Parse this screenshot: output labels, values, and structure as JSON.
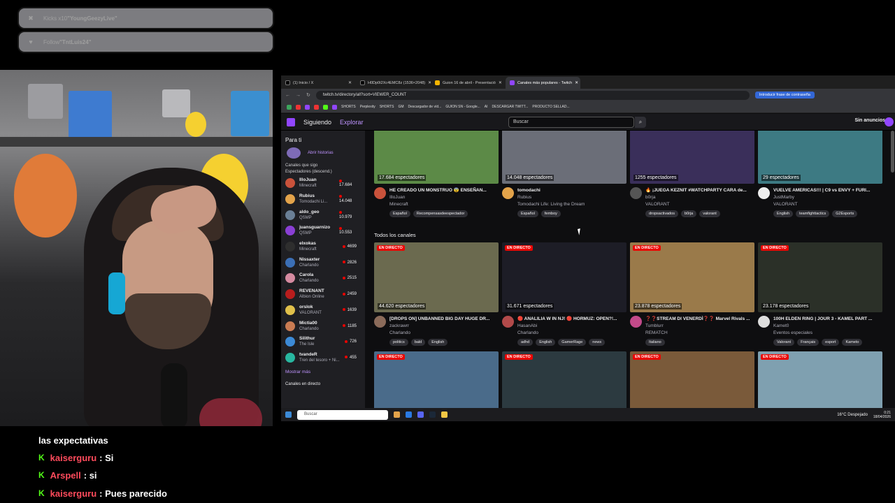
{
  "overlay": {
    "alerts": [
      {
        "icon": "kick-icon",
        "prefix": "Kicks x10 ",
        "name": "\"YoungGeezyLive\""
      },
      {
        "icon": "heart-icon",
        "prefix": "Follow ",
        "name": "\"TntLuis24\""
      }
    ],
    "chat": [
      {
        "user": "",
        "text": "las expectativas"
      },
      {
        "user": "kaiserguru",
        "text": ": Si"
      },
      {
        "user": "Arspell",
        "text": ": si"
      },
      {
        "user": "kaiserguru",
        "text": ": Pues parecido"
      }
    ],
    "chat_icon": "K",
    "colors": {
      "kick": "#53fc18",
      "chat_user": "#ff4b5c",
      "twitch": "#9146ff"
    }
  },
  "browser": {
    "tabs": [
      {
        "label": "(1) Inicio / X",
        "active": false
      },
      {
        "label": "H0Dp0t2Xc4EMC8z (1536×2048)",
        "active": false
      },
      {
        "label": "Guion 16 de abril - Presentació",
        "active": false
      },
      {
        "label": "Canales más populares - Twitch",
        "active": true
      }
    ],
    "url": "twitch.tv/directory/all?sort=VIEWER_COUNT",
    "password_btn": "Introducir frase de contraseña",
    "bookmarks": [
      "SHORTS",
      "Perplexity",
      "SHORTS",
      "GM",
      "Descargador de víd...",
      "GUION SN - Google...",
      "AI",
      "DESCARGAR TWITT...",
      "PRODUCTO SELLAD..."
    ]
  },
  "twitch": {
    "nav": {
      "following": "Siguiendo",
      "browse": "Explorar"
    },
    "search_placeholder": "Buscar",
    "no_ads": "Sin anuncios",
    "sidebar": {
      "for_you": "Para ti",
      "history": "Abrir historias",
      "followed": "Canales que sigo",
      "sort": "Espectadores (descend.)",
      "channels": [
        {
          "name": "IlloJuan",
          "game": "Minecraft",
          "viewers": "17.684",
          "color": "#c9523b"
        },
        {
          "name": "Rubius",
          "game": "Tomodachi Li...",
          "viewers": "14.048",
          "color": "#e3a34a"
        },
        {
          "name": "aldo_geo",
          "game": "QSMP",
          "viewers": "10.979",
          "color": "#6a7f96"
        },
        {
          "name": "juansguarnizo",
          "game": "QSMP",
          "viewers": "10.553",
          "color": "#8a3fd4"
        },
        {
          "name": "elxokas",
          "game": "Minecraft",
          "viewers": "4699",
          "color": "#2e2e2e"
        },
        {
          "name": "Nissaxter",
          "game": "Charlando",
          "viewers": "2826",
          "color": "#3b6fb6"
        },
        {
          "name": "Carola",
          "game": "Charlando",
          "viewers": "2515",
          "color": "#d58aa0"
        },
        {
          "name": "REVENANT",
          "game": "Albion Online",
          "viewers": "2459",
          "color": "#b81d1d"
        },
        {
          "name": "orslok",
          "game": "VALORANT",
          "viewers": "1639",
          "color": "#e0c04a"
        },
        {
          "name": "Mictia00",
          "game": "Charlando",
          "viewers": "1185",
          "color": "#c97b52"
        },
        {
          "name": "Silithur",
          "game": "The Isle",
          "viewers": "726",
          "color": "#3c8ad6"
        },
        {
          "name": "tvandeR",
          "game": "Tren del tesoro + Ni...",
          "viewers": "455",
          "color": "#28b7a0"
        }
      ],
      "show_more": "Mostrar más",
      "live_channels": "Canales en directo"
    },
    "section_title": "Todos los canales",
    "live_label": "EN DIRECTO",
    "row1": [
      {
        "views": "17.684 espectadores",
        "title": "HE CREADO UN MONSTRUO 😨 ENSEÑAN...",
        "channel": "IlloJuan",
        "game": "Minecraft",
        "tags": [
          "Español",
          "Recompensasdeespectador"
        ],
        "bg": "#5c8a47",
        "av": "#c9523b"
      },
      {
        "views": "14.048 espectadores",
        "title": "tomodachi",
        "channel": "Rubius",
        "game": "Tomodachi Life: Living the Dream",
        "tags": [
          "Español",
          "femboy"
        ],
        "bg": "#6b6e78",
        "av": "#e3a34a"
      },
      {
        "views": "1255 espectadores",
        "title": "🔥 ¡JUEGA KEZNIT #WATCHPARTY CARA de...",
        "channel": "b0rja",
        "game": "VALORANT",
        "tags": [
          "dropsactivados",
          "b0rja",
          "valorant"
        ],
        "bg": "#3a2f5a",
        "av": "#555"
      },
      {
        "views": "29 espectadores",
        "title": "VUELVE AMERICAS!!! | C9 vs ENVY + FURI...",
        "channel": "JustMarby",
        "game": "VALORANT",
        "tags": [
          "English",
          "teamfighttactics",
          "G2Esports"
        ],
        "bg": "#3d7a83",
        "av": "#eee"
      }
    ],
    "row2": [
      {
        "views": "44.620 espectadores",
        "title": "[DROPS ON] UNBANNED BIG DAY HUGE DR...",
        "channel": "zackrawrr",
        "game": "Charlando",
        "tags": [
          "politics",
          "bald",
          "English"
        ],
        "bg": "#6b6a4f",
        "av": "#8b6b5a"
      },
      {
        "views": "31.671 espectadores",
        "title": "🔴 ANALILIA W IN NJ! 🔴 HORMUZ: OPEN?!...",
        "channel": "HasanAbi",
        "game": "Charlando",
        "tags": [
          "adhd",
          "English",
          "GamerRage",
          "news"
        ],
        "bg": "#1d1d26",
        "av": "#b24a4a"
      },
      {
        "views": "23.878 espectadores",
        "title": "❓❓STREAM DI VENERDÌ❓❓ Marvel Rivals ...",
        "channel": "Tumblurr",
        "game": "REMATCH",
        "tags": [
          "Italiano"
        ],
        "bg": "#9a7a4a",
        "av": "#c34a8a"
      },
      {
        "views": "23.178 espectadores",
        "title": "100H ELDEN RING | JOUR 3 - KAMEL PART ...",
        "channel": "Kamet0",
        "game": "Eventos especiales",
        "tags": [
          "Valorant",
          "Français",
          "esport",
          "Kameto"
        ],
        "bg": "#2b3028",
        "av": "#ddd"
      }
    ],
    "row3": [
      {
        "bg": "#4a6b8a"
      },
      {
        "bg": "#2c3a40"
      },
      {
        "bg": "#7a5a3a"
      },
      {
        "bg": "#7fa0b0"
      }
    ]
  },
  "taskbar": {
    "search": "Buscar",
    "weather": "16°C  Despejado",
    "time": "0:21",
    "date": "18/04/2026"
  }
}
